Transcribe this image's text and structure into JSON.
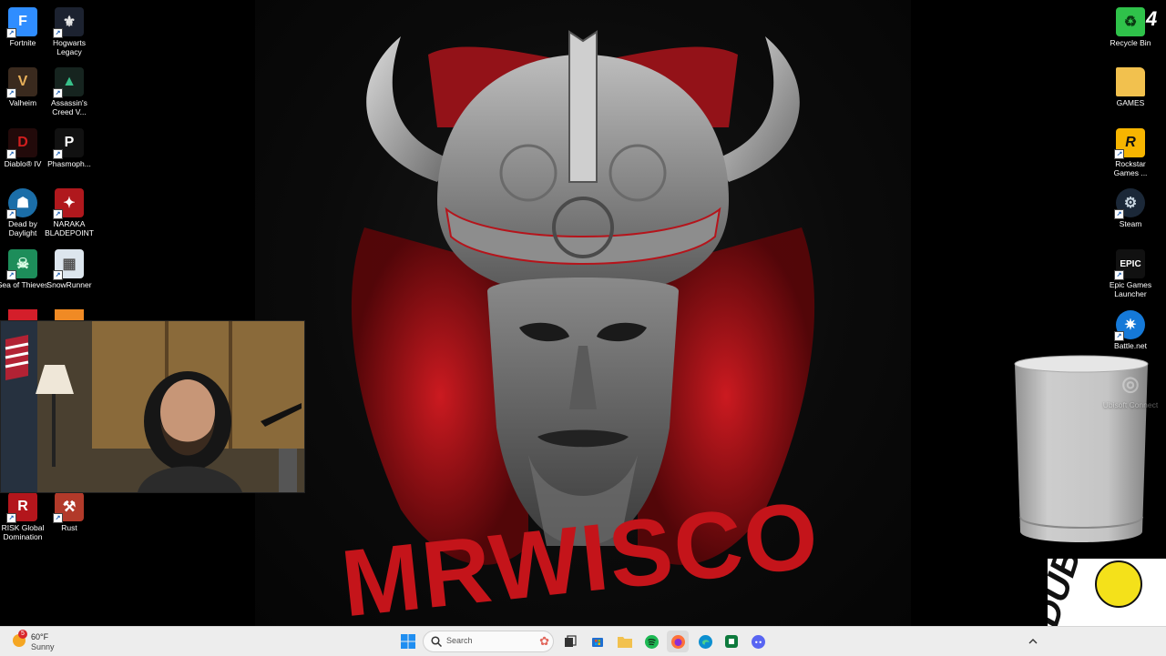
{
  "desktop": {
    "left_icons": [
      {
        "label": "Fortnite",
        "icon": "fortnite-icon",
        "bg": "#2f8dff",
        "glyph": "F"
      },
      {
        "label": "Hogwarts Legacy",
        "icon": "hogwarts-legacy-icon",
        "bg": "#1c2230",
        "glyph": "⚜"
      },
      {
        "label": "Valheim",
        "icon": "valheim-icon",
        "bg": "#3a2a1e",
        "glyph": "V"
      },
      {
        "label": "Assassin's Creed V...",
        "icon": "assassins-creed-icon",
        "bg": "#16241f",
        "glyph": "▲"
      },
      {
        "label": "Diablo® IV",
        "icon": "diablo-icon",
        "bg": "#220a0a",
        "glyph": "D"
      },
      {
        "label": "Phasmoph...",
        "icon": "phasmophobia-icon",
        "bg": "#111111",
        "glyph": "P"
      },
      {
        "label": "Dead by Daylight",
        "icon": "dead-by-daylight-icon",
        "bg": "#1b6ea8",
        "glyph": "☗"
      },
      {
        "label": "NARAKA BLADEPOINT",
        "icon": "naraka-icon",
        "bg": "#b0181d",
        "glyph": "✦"
      },
      {
        "label": "Sea of Thieves",
        "icon": "sea-of-thieves-icon",
        "bg": "#1d8d5a",
        "glyph": "☠"
      },
      {
        "label": "SnowRunner",
        "icon": "snowrunner-icon",
        "bg": "#dde6ee",
        "glyph": "▦"
      },
      {
        "label": "RISK Global Domination",
        "icon": "risk-icon",
        "bg": "#b3161c",
        "glyph": "R"
      },
      {
        "label": "Rust",
        "icon": "rust-icon",
        "bg": "#b23a2a",
        "glyph": "⚒"
      }
    ],
    "right_icons": [
      {
        "label": "Recycle Bin",
        "icon": "recycle-bin-icon",
        "bg": "#2fc24a",
        "glyph": "♻"
      },
      {
        "label": "GAMES",
        "icon": "folder-icon",
        "bg": "#f2c14e",
        "glyph": ""
      },
      {
        "label": "Rockstar Games ...",
        "icon": "rockstar-games-icon",
        "bg": "#f7b500",
        "glyph": "R"
      },
      {
        "label": "Steam",
        "icon": "steam-icon",
        "bg": "#1b2838",
        "glyph": "⚙"
      },
      {
        "label": "Epic Games Launcher",
        "icon": "epic-games-icon",
        "bg": "#111111",
        "glyph": "EPIC"
      },
      {
        "label": "Battle.net",
        "icon": "battle-net-icon",
        "bg": "#1579d8",
        "glyph": "✷"
      },
      {
        "label": "Ubisoft Connect",
        "icon": "ubisoft-connect-icon",
        "bg": "transparent",
        "glyph": "◎"
      }
    ],
    "wallpaper_text": "MRWISCO"
  },
  "taskbar": {
    "weather": {
      "temp": "60°F",
      "condition": "Sunny",
      "badge": "5",
      "icon": "sun-icon"
    },
    "search_placeholder": "Search",
    "apps": [
      {
        "name": "start-button",
        "icon": "windows-start-icon"
      },
      {
        "name": "task-view-button",
        "icon": "task-view-icon"
      },
      {
        "name": "microsoft-store-button",
        "icon": "store-icon"
      },
      {
        "name": "file-explorer-button",
        "icon": "folder-icon"
      },
      {
        "name": "spotify-button",
        "icon": "spotify-icon"
      },
      {
        "name": "firefox-button",
        "icon": "firefox-icon"
      },
      {
        "name": "edge-button",
        "icon": "edge-icon"
      },
      {
        "name": "app-button",
        "icon": "app-icon"
      },
      {
        "name": "discord-button",
        "icon": "discord-icon"
      }
    ],
    "tray_chevron_icon": "chevron-up-icon"
  },
  "overlay": {
    "sticker_text": "DUBBY"
  },
  "colors": {
    "accent_red": "#c4141a",
    "taskbar_bg": "#ededed"
  }
}
